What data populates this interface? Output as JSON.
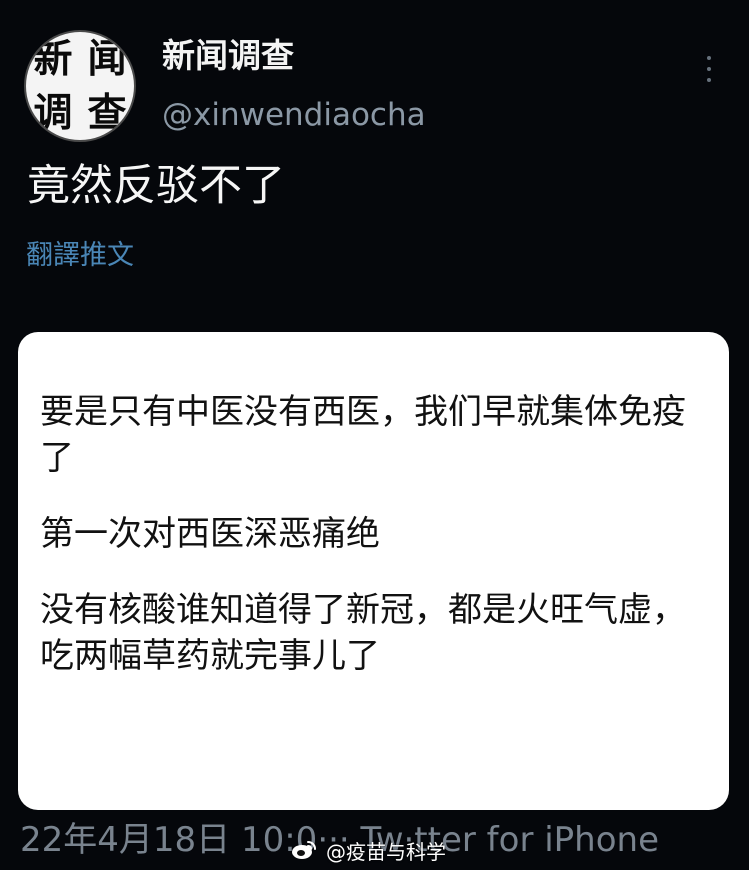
{
  "tweet": {
    "avatar_chars": [
      "新",
      "闻",
      "调",
      "查"
    ],
    "display_name": "新闻调查",
    "handle": "@xinwendiaocha",
    "text": "竟然反驳不了",
    "translate_label": "翻譯推文",
    "more_icon": "more-vertical-icon",
    "card": {
      "paragraphs": [
        "要是只有中医没有西医，我们早就集体免疫了",
        "第一次对西医深恶痛绝",
        "没有核酸谁知道得了新冠，都是火旺气虚，吃两幅草药就完事儿了"
      ]
    },
    "footer_visible": "22年4月18日 10:0··· Tw·tter for iPhone"
  },
  "watermark": {
    "text": "@疫苗与科学",
    "icon": "weibo-icon"
  },
  "colors": {
    "background": "#05070b",
    "link": "#4a86b6",
    "muted": "#8b98a5",
    "card": "#ffffff"
  }
}
